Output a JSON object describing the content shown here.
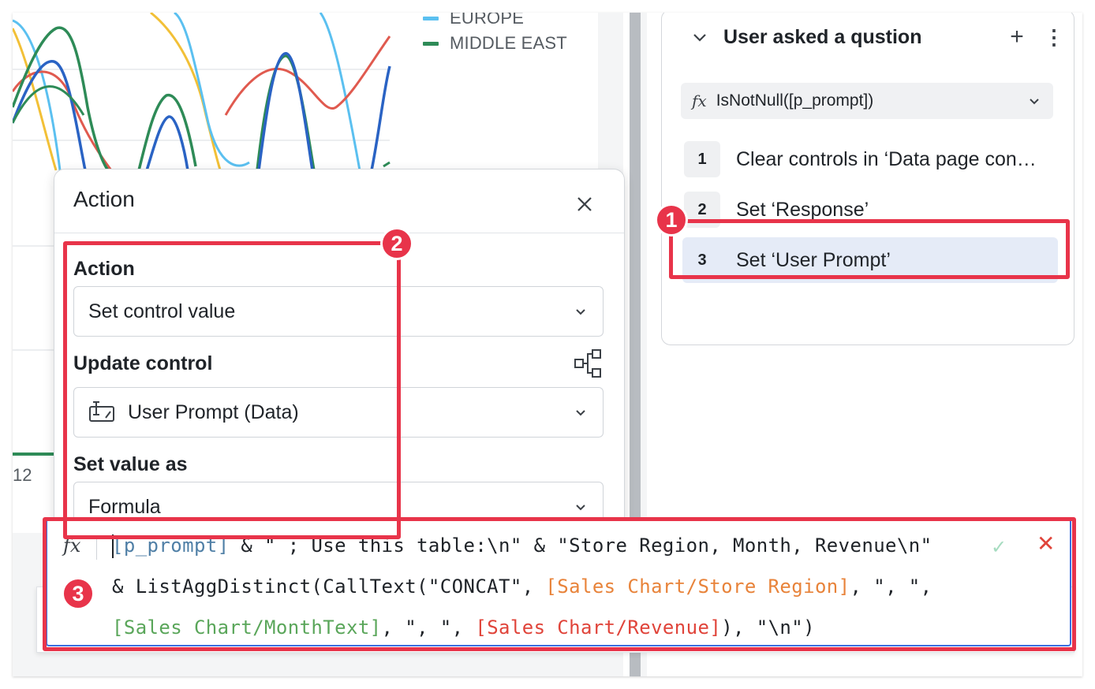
{
  "colors": {
    "accent_blue": "#3a6fe0",
    "annotation_red": "#e8344a",
    "code_param": "#4f7fa6",
    "code_orange": "#e8833a",
    "code_green": "#5aa65a",
    "code_red": "#e0443a"
  },
  "chart": {
    "legend": [
      {
        "label": "EUROPE",
        "color": "#5bc0f0"
      },
      {
        "label": "MIDDLE EAST",
        "color": "#2e8b57"
      }
    ],
    "x_tick_visible": "12"
  },
  "action_modal": {
    "title": "Action",
    "close_icon": "close-icon",
    "action": {
      "label": "Action",
      "value": "Set control value"
    },
    "update_control": {
      "label": "Update control",
      "value": "User Prompt (Data)",
      "control_icon": "text-input-control-icon",
      "lineage_icon": "lineage-icon"
    },
    "set_value_as": {
      "label": "Set value as",
      "value": "Formula"
    }
  },
  "sequence": {
    "title": "User asked a qustion",
    "add_icon": "+",
    "more_icon": "⋮",
    "condition": {
      "fx": "fx",
      "text": "IsNotNull([p_prompt])"
    },
    "steps": [
      {
        "number": "1",
        "label": "Clear controls in ‘Data page con…"
      },
      {
        "number": "2",
        "label": "Set ‘Response’"
      },
      {
        "number": "3",
        "label": "Set ‘User Prompt’"
      }
    ],
    "selected_step": "3"
  },
  "formula_bar": {
    "fx": "fx",
    "line1": {
      "param": "[p_prompt]",
      "text": " & \" ; Use this table:\\n\" & \"Store Region, Month, Revenue\\n\""
    },
    "line2": {
      "text_a": "& ListAggDistinct(CallText(\"CONCAT\", ",
      "col_region": "[Sales Chart/Store Region]",
      "text_b": ", \", \","
    },
    "line3": {
      "col_month": "[Sales Chart/MonthText]",
      "text_a": ", \", \", ",
      "col_revenue": "[Sales Chart/Revenue]",
      "text_b": "), \"\\n\")"
    },
    "accept_icon": "✓",
    "cancel_icon": "✕"
  },
  "annotations": [
    {
      "number": "1",
      "target": "selected step 3"
    },
    {
      "number": "2",
      "target": "action fields"
    },
    {
      "number": "3",
      "target": "formula bar"
    }
  ]
}
